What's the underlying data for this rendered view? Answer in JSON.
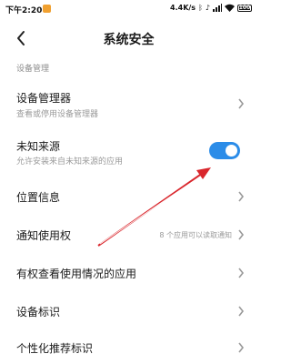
{
  "status_bar": {
    "time": "下午2:20",
    "net_speed": "4.4K/s",
    "battery": "100",
    "battery_level": 0.98,
    "icons": [
      "app-notification-icon",
      "bluetooth-icon",
      "mute-icon",
      "signal-icon",
      "wifi-icon",
      "battery-icon"
    ]
  },
  "header": {
    "title": "系统安全",
    "back_icon": "back-arrow-icon"
  },
  "section": {
    "label": "设备管理"
  },
  "items": {
    "device_manager": {
      "title": "设备管理器",
      "subtitle": "查看或停用设备管理器"
    },
    "unknown_sources": {
      "title": "未知来源",
      "subtitle": "允许安装来自未知来源的应用",
      "enabled": true
    },
    "location": {
      "title": "位置信息"
    },
    "notification_access": {
      "title": "通知使用权",
      "value": "8 个应用可以读取通知"
    },
    "usage_access": {
      "title": "有权查看使用情况的应用"
    },
    "device_id": {
      "title": "设备标识"
    },
    "personalized_ad_id": {
      "title": "个性化推荐标识"
    }
  },
  "colors": {
    "accent": "#2b8ce8",
    "annotation_arrow": "#d9262c"
  }
}
